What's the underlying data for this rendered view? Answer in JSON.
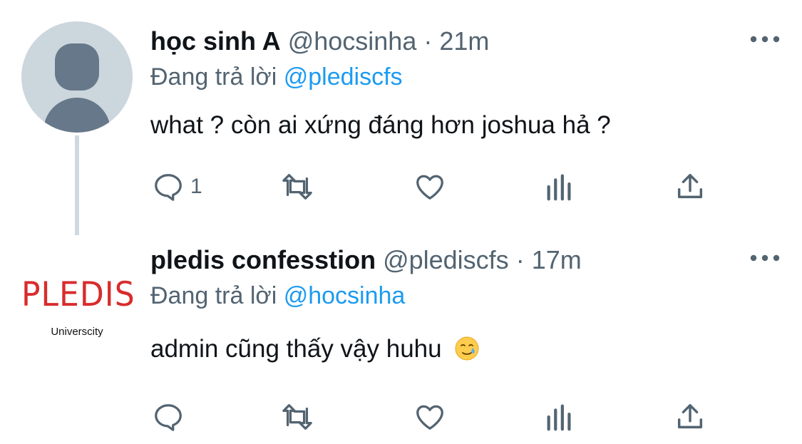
{
  "thread": {
    "tweets": [
      {
        "name": "học sinh A",
        "handle": "@hocsinha",
        "separator": "·",
        "time": "21m",
        "reply_prefix": "Đang trả lời",
        "reply_to": "@plediscfs",
        "text": "what ? còn ai xứng đáng hơn joshua hả ?",
        "avatar_icon": "default-profile-avatar",
        "actions": {
          "reply_icon": "comment-icon",
          "reply_count": "1",
          "retweet_icon": "retweet-icon",
          "like_icon": "heart-icon",
          "views_icon": "analytics-icon",
          "share_icon": "share-icon"
        }
      },
      {
        "name": "pledis confesstion",
        "handle": "@plediscfs",
        "separator": "·",
        "time": "17m",
        "reply_prefix": "Đang trả lời",
        "reply_to": "@hocsinha",
        "text": "admin cũng thấy vậy huhu",
        "emoji": "crying-smiling-face-emoji",
        "avatar_logo_text": "PLEDIS",
        "avatar_logo_subtext": "Universcity",
        "actions": {
          "reply_icon": "comment-icon",
          "retweet_icon": "retweet-icon",
          "like_icon": "heart-icon",
          "views_icon": "analytics-icon",
          "share_icon": "share-icon"
        }
      }
    ]
  },
  "colors": {
    "text_primary": "#0f1419",
    "text_secondary": "#536471",
    "mention": "#1d9bf0",
    "thread_line": "#cfd9de",
    "avatar_bg": "#ccd6dd",
    "avatar_fg": "#67788a",
    "brand_red": "#d82c2c"
  }
}
